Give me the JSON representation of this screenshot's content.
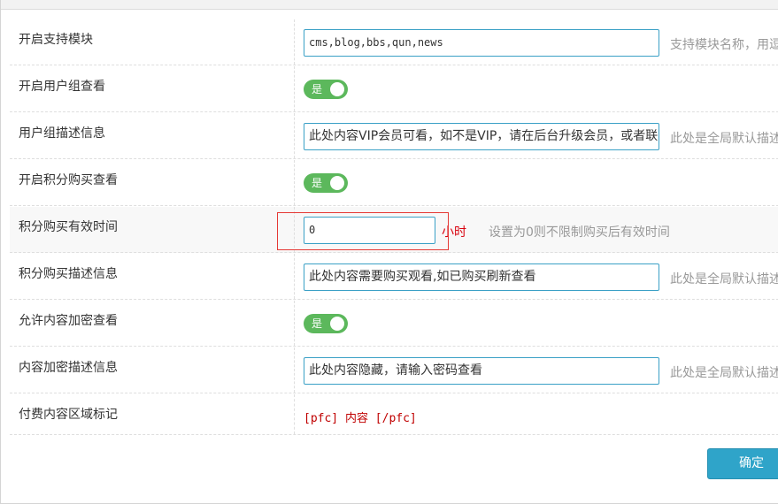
{
  "rows": [
    {
      "label": "开启支持模块",
      "value": "cms,blog,bbs,qun,news",
      "hint": "支持模块名称，用逗号"
    },
    {
      "label": "开启用户组查看",
      "toggle": "是"
    },
    {
      "label": "用户组描述信息",
      "value": "此处内容VIP会员可看，如不是VIP，请在后台升级会员，或者联系",
      "hint": "此处是全局默认描述"
    },
    {
      "label": "开启积分购买查看",
      "toggle": "是"
    },
    {
      "label": "积分购买有效时间",
      "value": "0",
      "unit": "小时",
      "hint": "设置为0则不限制购买后有效时间"
    },
    {
      "label": "积分购买描述信息",
      "value": "此处内容需要购买观看,如已购买刷新查看",
      "hint": "此处是全局默认描述"
    },
    {
      "label": "允许内容加密查看",
      "toggle": "是"
    },
    {
      "label": "内容加密描述信息",
      "value": "此处内容隐藏，请输入密码查看",
      "hint": "此处是全局默认描述"
    },
    {
      "label": "付费内容区域标记",
      "tag": "[pfc] 内容 [/pfc]"
    }
  ],
  "confirm_label": "确定",
  "colors": {
    "toggle_on": "#5cb85c",
    "input_border": "#3aa0c6",
    "button": "#2fa4c9",
    "unit_red": "#d9000d",
    "highlight_border": "#e53935"
  }
}
